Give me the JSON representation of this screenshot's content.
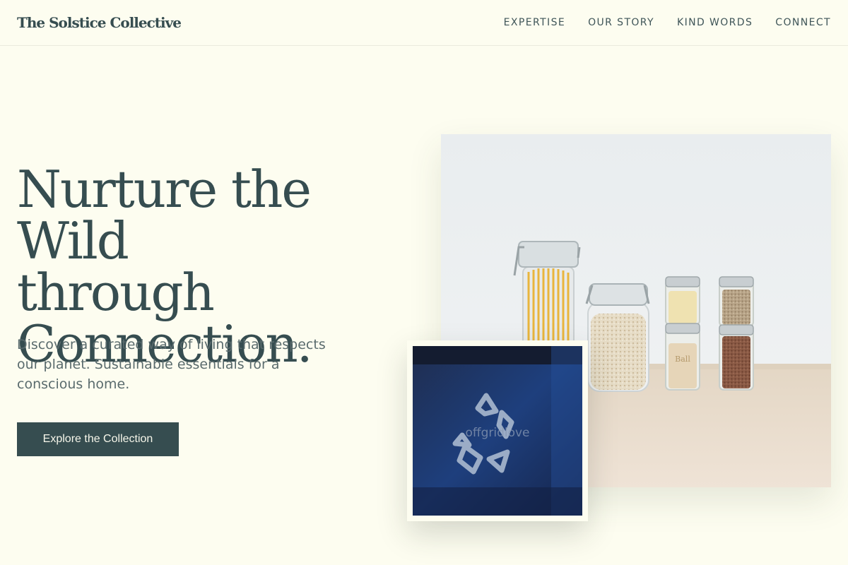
{
  "brand": "The Solstice Collective",
  "nav": [
    "EXPERTISE",
    "OUR STORY",
    "KIND WORDS",
    "CONNECT"
  ],
  "hero": {
    "title_lines": [
      "Nurture the Wild",
      "through",
      "Connection."
    ],
    "subtitle": "Discover a curated way of living that respects our planet. Sustainable essentials for a conscious home.",
    "cta_label": "Explore the Collection"
  },
  "images": {
    "main": "pantry-jars-photo",
    "inset": "recycling-bin-photo",
    "inset_watermark": "offgridlove"
  },
  "colors": {
    "background": "#fdfdf0",
    "primary": "#364d50",
    "muted_text": "#5a6b6d"
  }
}
